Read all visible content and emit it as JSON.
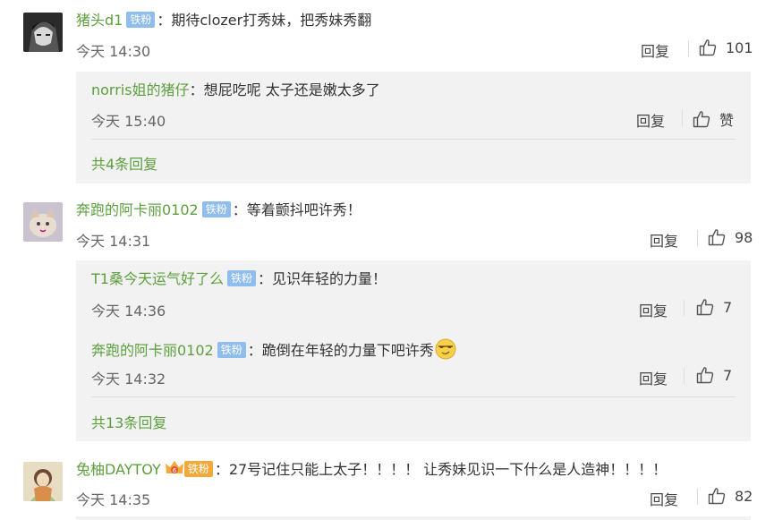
{
  "badge_label": "铁粉",
  "comments": [
    {
      "user": "猪头d1",
      "text": "期待clozer打秀妹，把秀妹秀翻",
      "time": "今天 14:30",
      "reply_label": "回复",
      "likes": "101",
      "replies": [
        {
          "user": "norris姐的猪仔",
          "text": "想屁吃呢 太子还是嫩太多了",
          "time": "今天 15:40",
          "reply_label": "回复",
          "likes": "赞"
        }
      ],
      "more": "共4条回复"
    },
    {
      "user": "奔跑的阿卡丽0102",
      "text": "等着颤抖吧许秀！",
      "time": "今天 14:31",
      "reply_label": "回复",
      "likes": "98",
      "replies": [
        {
          "user": "T1桑今天运气好了么",
          "text": "见识年轻的力量！",
          "time": "今天 14:36",
          "reply_label": "回复",
          "likes": "7"
        },
        {
          "user": "奔跑的阿卡丽0102",
          "text": "跪倒在年轻的力量下吧许秀",
          "time": "今天 14:32",
          "reply_label": "回复",
          "likes": "7"
        }
      ],
      "more": "共13条回复"
    },
    {
      "user": "兔柚DAYTOY",
      "text": "27号记住只能上太子！！！！ 让秀妹见识一下什么是人造神！！！！",
      "time": "今天 14:35",
      "reply_label": "回复",
      "likes": "82"
    }
  ],
  "colon": "：",
  "colors": {
    "username": "#5d9f3e",
    "badge": "#8fbdee",
    "sub_bg": "#f2f2f2"
  }
}
